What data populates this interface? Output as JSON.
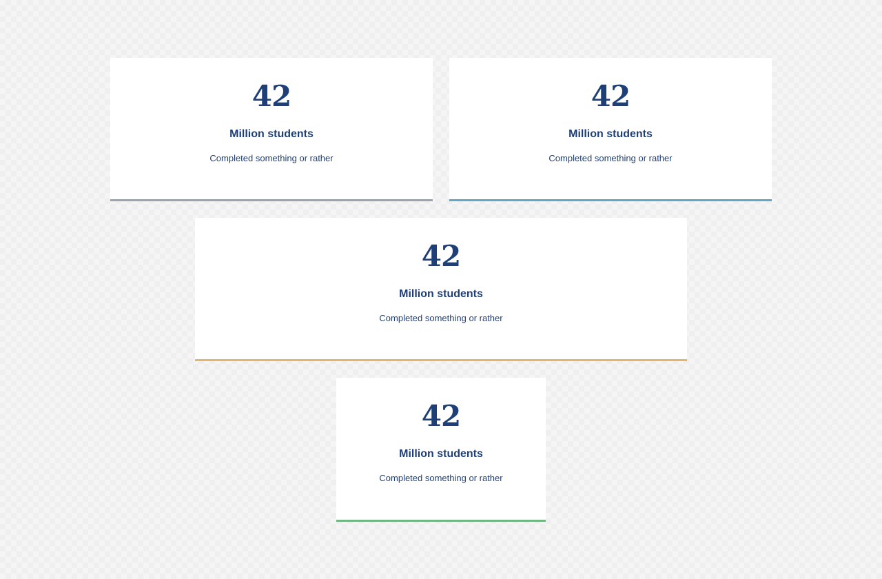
{
  "cards": [
    {
      "number": "42",
      "title": "Million students",
      "description": "Completed something or rather",
      "accent_color": "#9aa3b0"
    },
    {
      "number": "42",
      "title": "Million students",
      "description": "Completed something or rather",
      "accent_color": "#5fa8c4"
    },
    {
      "number": "42",
      "title": "Million students",
      "description": "Completed something or rather",
      "accent_color": "#e5b56e"
    },
    {
      "number": "42",
      "title": "Million students",
      "description": "Completed something or rather",
      "accent_color": "#72b683"
    }
  ]
}
